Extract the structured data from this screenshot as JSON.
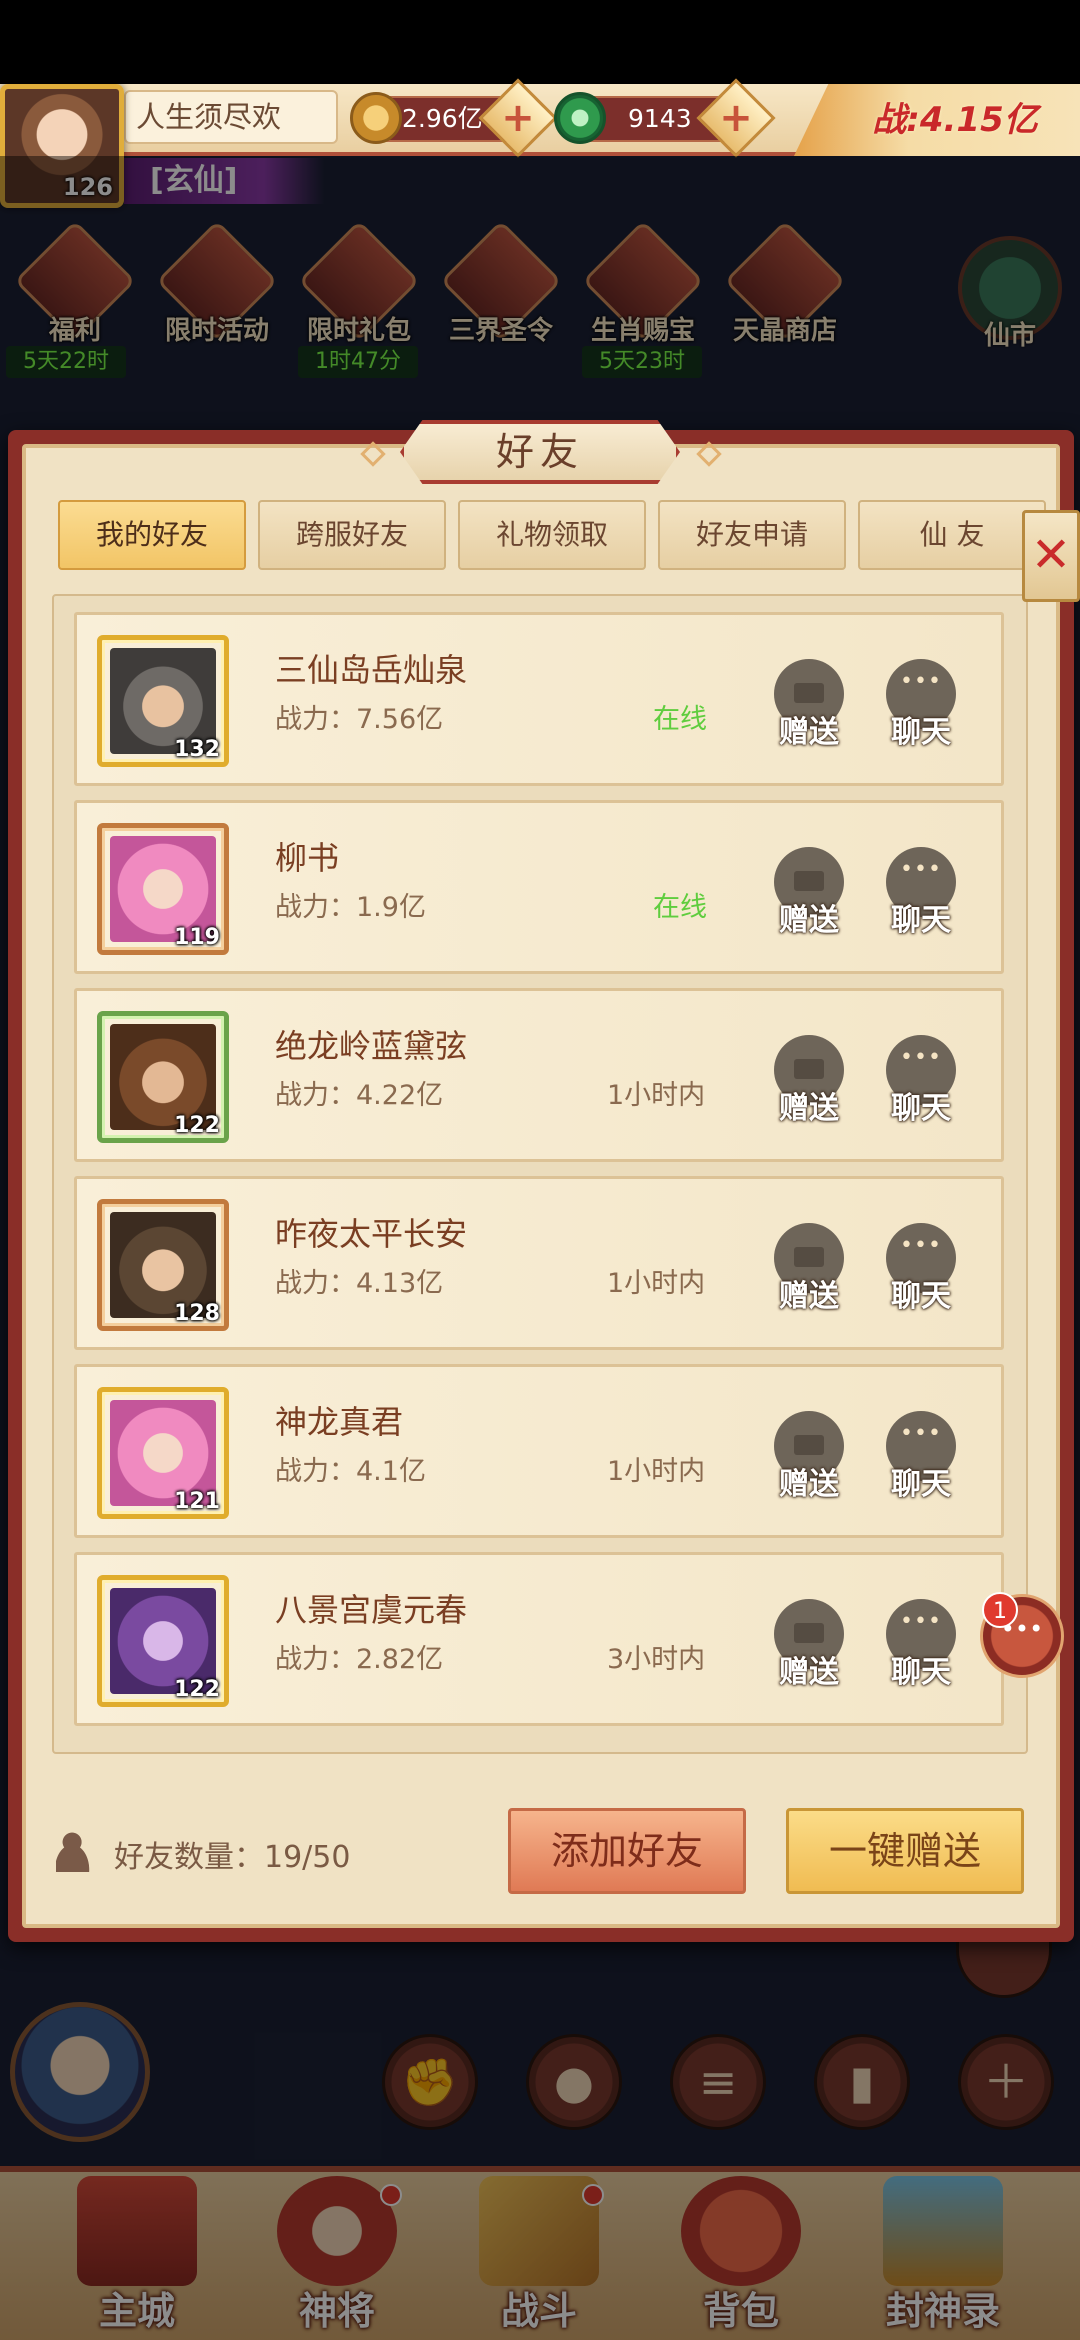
{
  "hud": {
    "player_name": "人生须尽欢",
    "player_level": "126",
    "rank_title": "[玄仙]",
    "coins": "2.96亿",
    "jade": "9143",
    "power": "战:4.15亿",
    "plus": "+"
  },
  "activities": [
    {
      "label": "福利",
      "timer": "5天22时"
    },
    {
      "label": "限时活动",
      "timer": ""
    },
    {
      "label": "限时礼包",
      "timer": "1时47分"
    },
    {
      "label": "三界圣令",
      "timer": ""
    },
    {
      "label": "生肖赐宝",
      "timer": "5天23时"
    },
    {
      "label": "天晶商店",
      "timer": ""
    }
  ],
  "xianshi_label": "仙市",
  "modal": {
    "title": "好友",
    "close": "✕",
    "tabs": [
      {
        "label": "我的好友",
        "active": true
      },
      {
        "label": "跨服好友",
        "active": false
      },
      {
        "label": "礼物领取",
        "active": false
      },
      {
        "label": "好友申请",
        "active": false
      },
      {
        "label": "仙 友",
        "active": false
      }
    ],
    "friends": [
      {
        "name": "三仙岛岳灿泉",
        "power": "战力：7.56亿",
        "status": "在线",
        "level": "132"
      },
      {
        "name": "柳书",
        "power": "战力：1.9亿",
        "status": "在线",
        "level": "119"
      },
      {
        "name": "绝龙岭蓝黛弦",
        "power": "战力：4.22亿",
        "status": "1小时内",
        "level": "122"
      },
      {
        "name": "昨夜太平长安",
        "power": "战力：4.13亿",
        "status": "1小时内",
        "level": "128"
      },
      {
        "name": "神龙真君",
        "power": "战力：4.1亿",
        "status": "1小时内",
        "level": "121"
      },
      {
        "name": "八景宫虞元春",
        "power": "战力：2.82亿",
        "status": "3小时内",
        "level": "122"
      }
    ],
    "gift_label": "赠送",
    "chat_label": "聊天",
    "friend_count": "好友数量：19/50",
    "add_friend": "添加好友",
    "gift_all": "一键赠送"
  },
  "chat_badge": "1",
  "bottom_nav": [
    {
      "label": "主城"
    },
    {
      "label": "神将"
    },
    {
      "label": "战斗"
    },
    {
      "label": "背包"
    },
    {
      "label": "封神录"
    }
  ]
}
